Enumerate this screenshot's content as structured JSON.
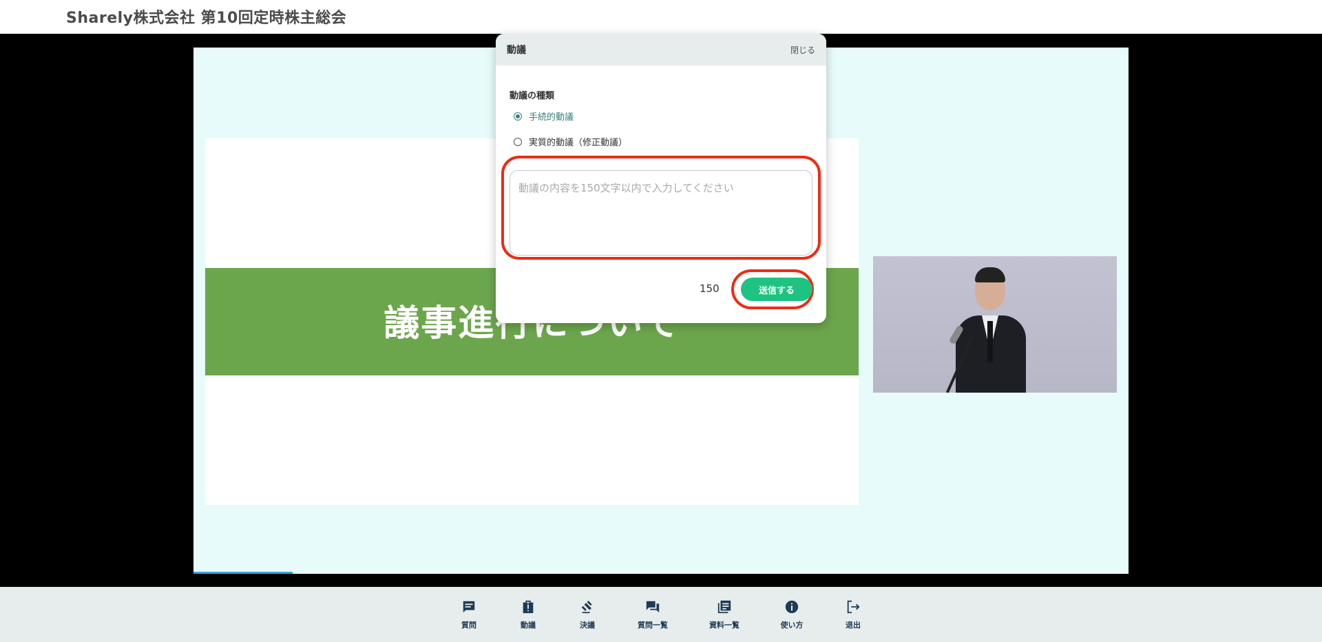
{
  "header": {
    "title": "Sharely株式会社 第10回定時株主総会"
  },
  "slide": {
    "heading": "議事進行について"
  },
  "colors": {
    "accent": "#1ec281",
    "highlight": "#ee2b14",
    "selected": "#3a7f80",
    "toolbar_icon": "#1e3a55"
  },
  "modal": {
    "title": "動議",
    "close_label": "閉じる",
    "section_label": "動議の種類",
    "options": [
      {
        "label": "手続的動議",
        "selected": true
      },
      {
        "label": "実質的動議（修正動議）",
        "selected": false
      }
    ],
    "textarea": {
      "value": "",
      "placeholder": "動議の内容を150文字以内で入力してください"
    },
    "char_remaining": "150",
    "submit_label": "送信する"
  },
  "toolbar": {
    "items": [
      {
        "label": "質問",
        "icon": "chat-icon"
      },
      {
        "label": "動議",
        "icon": "motion-icon"
      },
      {
        "label": "決議",
        "icon": "gavel-icon"
      },
      {
        "label": "質問一覧",
        "icon": "forum-icon"
      },
      {
        "label": "資料一覧",
        "icon": "library-icon"
      },
      {
        "label": "使い方",
        "icon": "info-icon"
      },
      {
        "label": "退出",
        "icon": "logout-icon"
      }
    ]
  }
}
